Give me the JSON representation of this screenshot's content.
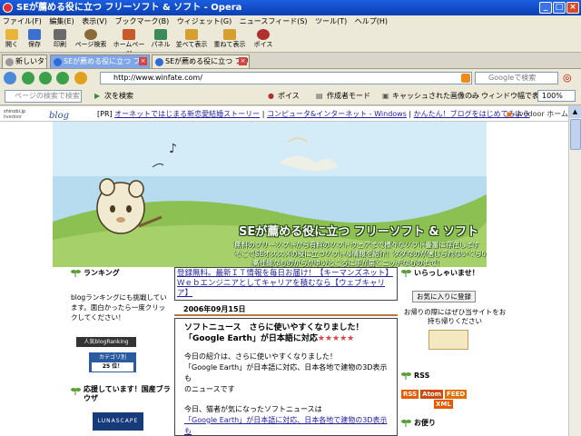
{
  "window": {
    "title": "SEが薦める役に立つ フリーソフト & ソフト - Opera"
  },
  "menu": [
    "ファイル(F)",
    "編集(E)",
    "表示(V)",
    "ブックマーク(B)",
    "ウィジェット(G)",
    "ニュースフィード(S)",
    "ツール(T)",
    "ヘルプ(H)"
  ],
  "toolbar": [
    {
      "label": "開く",
      "color": "#e8b43a"
    },
    {
      "label": "保存",
      "color": "#3d6fd0"
    },
    {
      "label": "印刷",
      "color": "#6a6a6a"
    },
    {
      "label": "ページ検索",
      "color": "#8a6a3a"
    },
    {
      "label": "ホームページ",
      "color": "#c85a2a"
    },
    {
      "label": "パネル",
      "color": "#3a8a5a"
    },
    {
      "label": "並べて表示",
      "color": "#d6a030"
    },
    {
      "label": "重ねて表示",
      "color": "#d6a030"
    },
    {
      "label": "ポイス",
      "color": "#b03030"
    }
  ],
  "tabs": {
    "new_tab": "新しいタブ",
    "tab1": "SEが薦める役に立つ フリー...",
    "tab2": "SEが薦める役に立つ フリー..."
  },
  "address": {
    "url": "http://www.winfate.com/",
    "search_placeholder": "Googleで検索"
  },
  "findbar": {
    "placeholder": "ページの検索で検索",
    "next": "次を検索",
    "voice": "ポイス",
    "author_mode": "作成者モード",
    "cache_images": "キャッシュされた画像のみ",
    "fit_width": "ウィンドウ幅で表示",
    "zoom": "100%"
  },
  "page": {
    "ld_logo": "shinobi.jp livedoor blog",
    "ld_pr": "[PR]",
    "ld_links": [
      "オーネットではじまる新恋愛結婚ストーリー",
      "コンピュータ&インターネット - Windows",
      "かんたん！ブログをはじめてみよう"
    ],
    "ld_right": "livedoor ホーム",
    "banner_title": "SEが薦める役に立つ フリーソフト & ソフト",
    "banner_sub": [
      "無料のフリーソフトから有料のソフトウェアまで様々なソフト豊富に存在します",
      "そこでSEオススメの役に立つソフト＆情報を紹介！タダなのが信じられないくらいの",
      "高性能なものからかゆいところに手が届くニッチなものまで！"
    ],
    "left": {
      "ranking_head": "ランキング",
      "ranking_text": "blogランキングにも挑戦しています。面白かったら一度クリックしてください！",
      "badge1": "人気blogRanking",
      "badge2_top": "カテゴリ別",
      "badge2_rank": "25 位！",
      "browser_head": "応援しています！国産ブラウザ",
      "lunascape": "LUNASCAPE"
    },
    "center": {
      "ad1": "登録無料。最新ＩＴ情報を毎日お届け！【キーマンズネット】",
      "ad2": "Ｗｅｂエンジニアとしてキャリアを積むなら【ウェブキャリア】",
      "date": "2006年09月15日",
      "headline": "ソフトニュース　さらに使いやすくなりました！「Google Earth」が日本語に対応",
      "stars": "★★★★★",
      "p1": "今日の紹介は、さらに使いやすくなりました！",
      "p2": "「Google Earth」が日本語に対応、日本各地で建物の3D表示も",
      "p3": "のニュースです",
      "p4": "今日、猫者が気になったソフトニュースは",
      "link": "「Google Earth」が日本語に対応、日本各地で建物の3D表示も"
    },
    "right": {
      "welcome": "いらっしゃいませ！",
      "favorite_btn": "お気に入りに登録",
      "note": "お帰りの際にはぜひ当サイトをお持ち帰りください",
      "rss_head": "RSS",
      "rss_buttons": [
        "RSS",
        "Atom",
        "FEED",
        "XML"
      ],
      "bottom_head": "お便り"
    }
  },
  "colors": {
    "titlebar": "#1c5ee0",
    "link": "#1f1f9f",
    "sky": "#b7dcf0",
    "grass": "#8cc052"
  }
}
